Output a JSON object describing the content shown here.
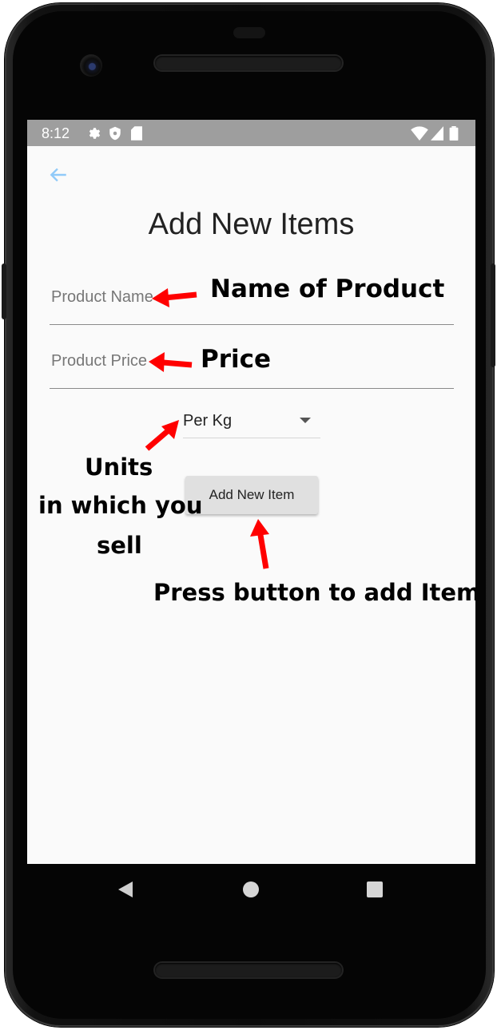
{
  "status_bar": {
    "time": "8:12",
    "icons": [
      "gear-icon",
      "shield-icon",
      "sd-card-icon",
      "wifi-icon",
      "signal-icon",
      "battery-icon"
    ]
  },
  "header": {
    "back_icon": "back-arrow-icon",
    "title": "Add New Items"
  },
  "form": {
    "product_name": {
      "placeholder": "Product Name",
      "value": ""
    },
    "product_price": {
      "placeholder": "Product Price",
      "value": ""
    },
    "unit": {
      "selected": "Per Kg"
    },
    "submit_label": "Add New Item"
  },
  "annotations": {
    "name": "Name of Product",
    "price": "Price",
    "units_line1": "Units",
    "units_line2": "in which you",
    "units_line3": "sell",
    "button": "Press button to add Item"
  },
  "nav": {
    "back_icon": "nav-back-icon",
    "home_icon": "nav-home-icon",
    "recent_icon": "nav-recent-icon"
  },
  "colors": {
    "accent": "#90caf9",
    "status_bar": "#9e9e9e",
    "annotation_arrow": "#ff0000",
    "button_bg": "#e0e0e0"
  }
}
